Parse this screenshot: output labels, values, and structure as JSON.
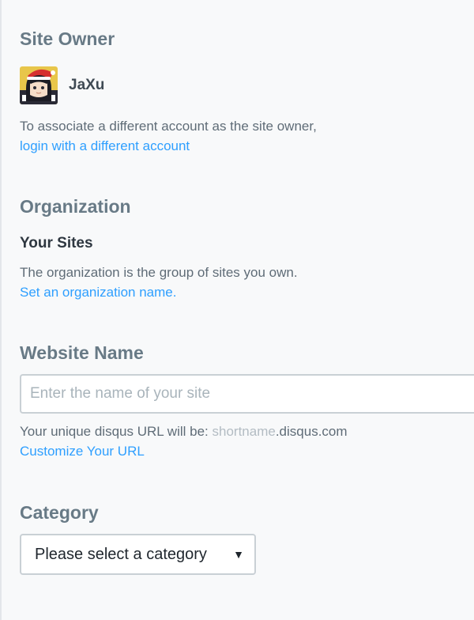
{
  "site_owner": {
    "heading": "Site Owner",
    "owner_name": "JaXu",
    "info_text": "To associate a different account as the site owner,",
    "link_text": "login with a different account"
  },
  "organization": {
    "heading": "Organization",
    "sub_heading": "Your Sites",
    "info_text": "The organization is the group of sites you own.",
    "link_text": "Set an organization name."
  },
  "website_name": {
    "heading": "Website Name",
    "placeholder": "Enter the name of your site",
    "url_prefix": "Your unique disqus URL will be: ",
    "url_shortname": "shortname",
    "url_suffix": ".disqus.com",
    "link_text": "Customize Your URL"
  },
  "category": {
    "heading": "Category",
    "selected": "Please select a category",
    "arrow_icon": "triangle-down-icon"
  },
  "colors": {
    "heading": "#687a86",
    "link": "#2e9fff",
    "text": "#5f6c77",
    "muted": "#b3bcc3",
    "border": "#c9d0d5"
  }
}
